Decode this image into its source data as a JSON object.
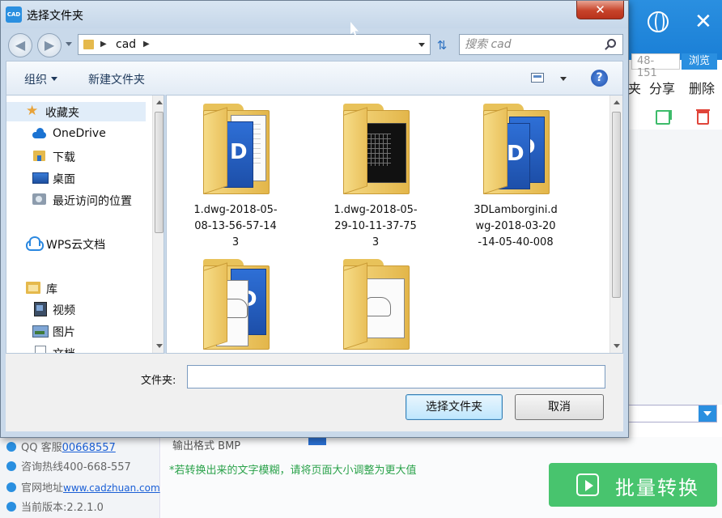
{
  "background_app": {
    "path_fragment": "48-151",
    "browse_label": "浏览",
    "toolbar": {
      "fragment": "夹",
      "share": "分享",
      "delete": "删除"
    },
    "left_info": {
      "qq_label": "QQ 客服",
      "qq_number": "00668557",
      "hotline": "咨询热线400-668-557",
      "website_label": "官网地址",
      "website_url": "www.cadzhuan.com",
      "version": "当前版本:2.2.1.0"
    },
    "output_format_label": "输出格式",
    "output_format_value": "BMP",
    "hint": "*若转换出来的文字模糊，请将页面大小调整为更大值",
    "batch_button": "批量转换",
    "accent_color": "#2a8fe0",
    "button_color": "#48c46e"
  },
  "dialog": {
    "title": "选择文件夹",
    "app_icon_text": "CAD",
    "close_symbol": "✕",
    "nav": {
      "back": "◀",
      "forward": "▶",
      "crumb": "cad",
      "search_placeholder": "搜索 cad"
    },
    "commands": {
      "organize": "组织",
      "new_folder": "新建文件夹",
      "help": "?"
    },
    "nav_tree": {
      "favorites": "收藏夹",
      "onedrive": "OneDrive",
      "downloads": "下载",
      "desktop": "桌面",
      "recent": "最近访问的位置",
      "wps_cloud": "WPS云文档",
      "libraries": "库",
      "videos": "视频",
      "pictures": "图片",
      "documents": "文档"
    },
    "files": [
      {
        "name": "1.dwg-2018-05-08-13-56-57-143",
        "line1": "1.dwg-2018-05-",
        "line2": "08-13-56-57-14",
        "line3": "3"
      },
      {
        "name": "1.dwg-2018-05-29-10-11-37-753",
        "line1": "1.dwg-2018-05-",
        "line2": "29-10-11-37-75",
        "line3": "3"
      },
      {
        "name": "3DLamborgini.dwg-2018-03-20-14-05-40-008",
        "line1": "3DLamborgini.d",
        "line2": "wg-2018-03-20",
        "line3": "-14-05-40-008"
      },
      {
        "name": "",
        "line1": "",
        "line2": "",
        "line3": ""
      },
      {
        "name": "",
        "line1": "",
        "line2": "",
        "line3": ""
      }
    ],
    "folder_label": "文件夹:",
    "folder_value": "",
    "select_button": "选择文件夹",
    "cancel_button": "取消"
  }
}
